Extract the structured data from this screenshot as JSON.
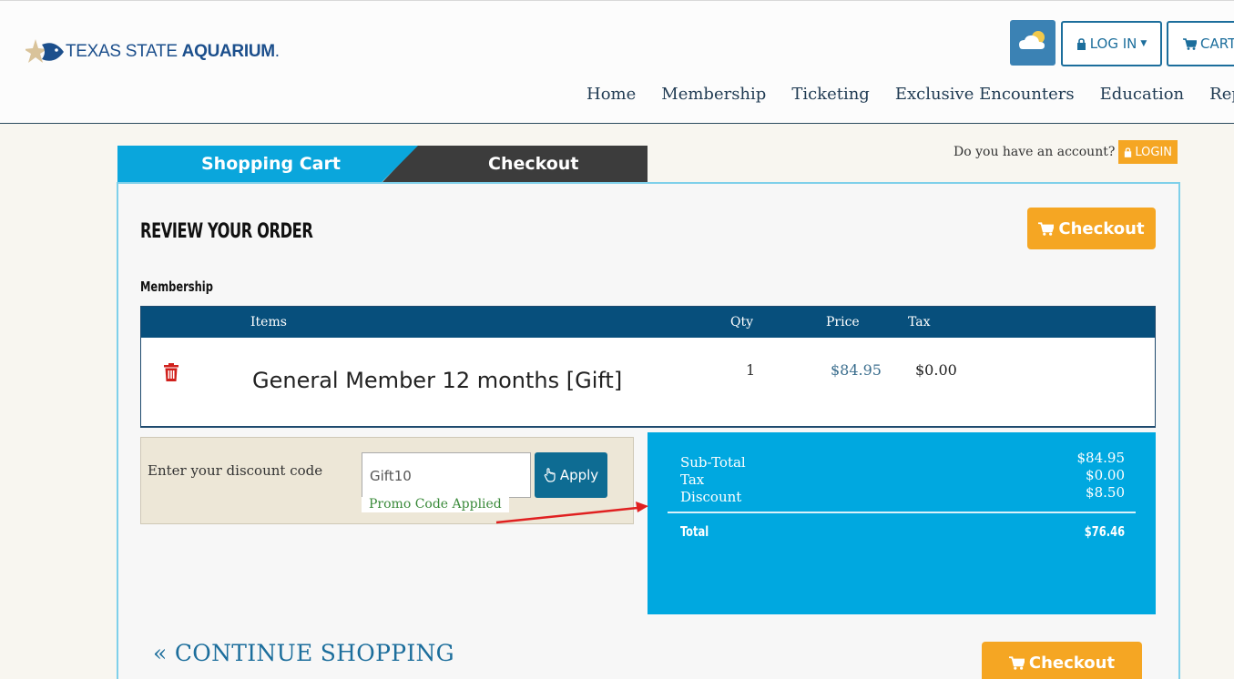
{
  "header": {
    "logo_light": "TEXAS STATE ",
    "logo_bold": "AQUARIUM",
    "logo_tm": ".",
    "login_label": "LOG IN",
    "cart_label": "CART",
    "nav": [
      "Home",
      "Membership",
      "Ticketing",
      "Exclusive Encounters",
      "Education",
      "Rep"
    ]
  },
  "steps": {
    "cart": "Shopping Cart",
    "checkout": "Checkout"
  },
  "account": {
    "prompt": "Do you have an account?",
    "login": "LOGIN"
  },
  "order": {
    "title": "REVIEW YOUR ORDER",
    "checkout_label": "Checkout",
    "section": "Membership",
    "columns": {
      "items": "Items",
      "qty": "Qty",
      "price": "Price",
      "tax": "Tax"
    },
    "rows": [
      {
        "name": "General Member 12 months [Gift]",
        "qty": "1",
        "price": "$84.95",
        "tax": "$0.00"
      }
    ]
  },
  "discount": {
    "label": "Enter your discount code",
    "value": "Gift10",
    "apply": "Apply",
    "status": "Promo Code Applied"
  },
  "summary": {
    "subtotal_label": "Sub-Total",
    "subtotal": "$84.95",
    "tax_label": "Tax",
    "tax": "$0.00",
    "discount_label": "Discount",
    "discount": "$8.50",
    "total_label": "Total",
    "total": "$76.46"
  },
  "footer": {
    "continue": "CONTINUE SHOPPING",
    "checkout_label": "Checkout"
  },
  "colors": {
    "accent_orange": "#f5a623",
    "tab_blue": "#0aa6dc",
    "header_navy": "#074f7c",
    "summary_blue": "#00a8e0",
    "arrow_red": "#e02020"
  },
  "icons": [
    "fish-star-logo-icon",
    "weather-icon",
    "lock-icon",
    "cart-icon",
    "trash-icon",
    "hand-pointer-icon",
    "double-chevron-left-icon"
  ]
}
